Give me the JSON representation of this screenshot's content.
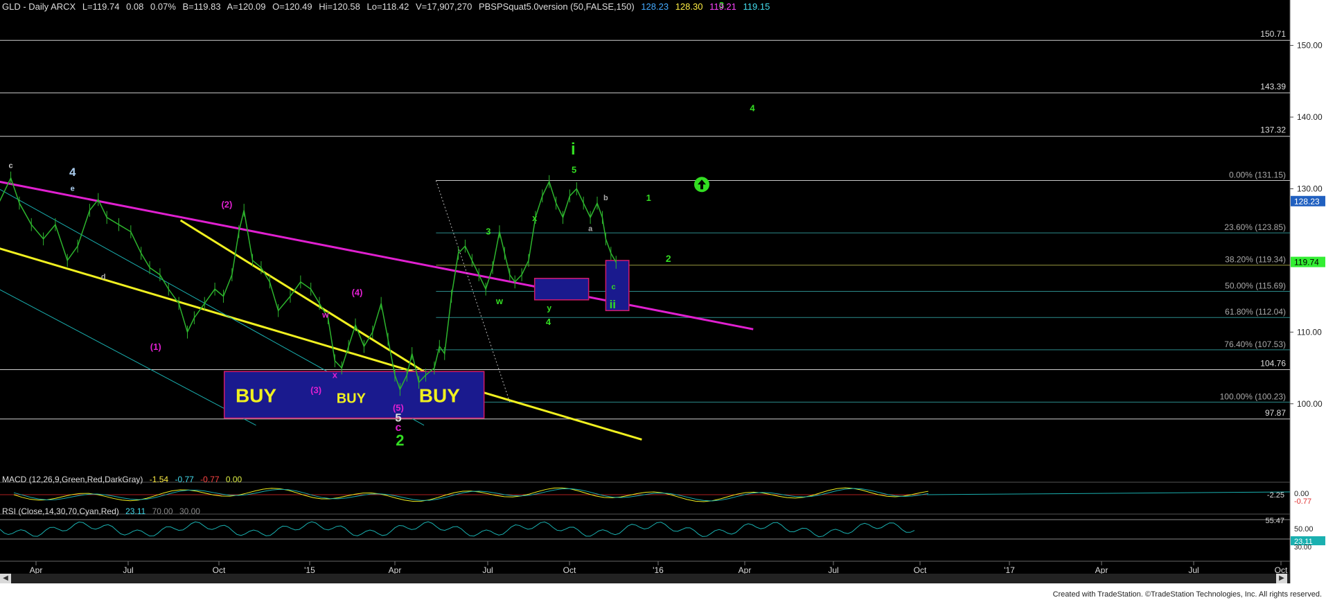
{
  "header": {
    "symbol": "GLD - Daily ARCX",
    "last": "L=119.74",
    "chg": "0.08",
    "pct": "0.07%",
    "bid": "B=119.83",
    "ask": "A=120.09",
    "open": "O=120.49",
    "hi": "Hi=120.58",
    "lo": "Lo=118.42",
    "vol": "V=17,907,270",
    "study": "PBSPSquat5.0version (50,FALSE,150)",
    "v1": "128.23",
    "v2": "128.30",
    "v3": "119.21",
    "v4": "119.15"
  },
  "macd_header": {
    "label": "MACD (12,26,9,Green,Red,DarkGray)",
    "v1": "-1.54",
    "v2": "-0.77",
    "v3": "-0.77",
    "v4": "0.00"
  },
  "rsi_header": {
    "label": "RSI (Close,14,30,70,Cyan,Red)",
    "v1": "23.11",
    "v2": "70.00",
    "v3": "30.00"
  },
  "credit": "Created with TradeStation. ©TradeStation Technologies, Inc. All rights reserved.",
  "colors": {
    "price": "#2db52d",
    "magenta": "#e020d0",
    "yellow": "#f0f020",
    "cyan": "#1ab0b0",
    "box": "#1a1a8e",
    "green_label": "#33dd22"
  },
  "chart_data": {
    "type": "line",
    "title": "GLD - Daily ARCX",
    "x_tick_labels": [
      "Apr",
      "Jul",
      "Oct",
      "'15",
      "Apr",
      "Jul",
      "Oct",
      "'16",
      "Apr",
      "Jul",
      "Oct",
      "'17",
      "Apr",
      "Jul",
      "Oct"
    ],
    "y_tick_labels": [
      "150.00",
      "140.00",
      "130.00",
      "110.00",
      "100.00"
    ],
    "ylim": [
      90.6,
      154.6
    ],
    "price_path": [
      [
        -100,
        128
      ],
      [
        -86,
        131.5
      ],
      [
        -76,
        128
      ],
      [
        -62,
        125
      ],
      [
        -48,
        123
      ],
      [
        -34,
        125
      ],
      [
        -20,
        120
      ],
      [
        -8,
        122
      ],
      [
        6,
        127
      ],
      [
        16,
        128.5
      ],
      [
        26,
        126
      ],
      [
        40,
        125
      ],
      [
        54,
        124
      ],
      [
        66,
        121
      ],
      [
        76,
        119
      ],
      [
        88,
        118
      ],
      [
        98,
        116
      ],
      [
        110,
        114
      ],
      [
        120,
        110
      ],
      [
        128,
        112
      ],
      [
        140,
        114
      ],
      [
        152,
        116
      ],
      [
        162,
        115
      ],
      [
        172,
        118
      ],
      [
        180,
        124
      ],
      [
        186,
        127
      ],
      [
        196,
        120
      ],
      [
        206,
        119
      ],
      [
        216,
        117
      ],
      [
        226,
        113
      ],
      [
        240,
        115
      ],
      [
        252,
        117
      ],
      [
        264,
        116
      ],
      [
        274,
        114
      ],
      [
        284,
        112
      ],
      [
        292,
        106
      ],
      [
        300,
        105
      ],
      [
        308,
        108
      ],
      [
        316,
        111
      ],
      [
        326,
        108
      ],
      [
        336,
        110
      ],
      [
        346,
        114
      ],
      [
        354,
        109
      ],
      [
        362,
        104
      ],
      [
        368,
        102
      ],
      [
        376,
        104
      ],
      [
        382,
        107
      ],
      [
        390,
        103
      ],
      [
        398,
        104
      ],
      [
        408,
        105
      ],
      [
        414,
        108
      ],
      [
        420,
        107
      ],
      [
        428,
        115
      ],
      [
        436,
        121
      ],
      [
        444,
        122
      ],
      [
        452,
        120
      ],
      [
        460,
        118
      ],
      [
        468,
        116
      ],
      [
        476,
        119
      ],
      [
        484,
        124
      ],
      [
        490,
        121
      ],
      [
        496,
        118
      ],
      [
        502,
        117
      ],
      [
        510,
        118
      ],
      [
        518,
        120
      ],
      [
        526,
        126
      ],
      [
        534,
        129
      ],
      [
        542,
        131
      ],
      [
        550,
        128
      ],
      [
        558,
        126
      ],
      [
        566,
        129
      ],
      [
        574,
        130
      ],
      [
        582,
        128
      ],
      [
        590,
        126
      ],
      [
        598,
        128
      ],
      [
        604,
        126
      ],
      [
        608,
        123
      ],
      [
        614,
        121
      ],
      [
        620,
        119.74
      ]
    ],
    "channel_lines": [
      {
        "color": "magenta",
        "points": [
          [
            -100,
            131
          ],
          [
            780,
            110.4
          ]
        ]
      },
      {
        "color": "yellow",
        "points": [
          [
            -100,
            121.7
          ],
          [
            650,
            95
          ]
        ]
      },
      {
        "color": "yellow",
        "points": [
          [
            112,
            125.6
          ],
          [
            416,
            103
          ]
        ]
      },
      {
        "color": "cyan",
        "points": [
          [
            -100,
            130
          ],
          [
            396,
            97
          ]
        ]
      },
      {
        "color": "cyan",
        "points": [
          [
            -100,
            116
          ],
          [
            200,
            97
          ]
        ]
      }
    ],
    "fib_levels": [
      {
        "label": "0.00% (131.15)",
        "value": 131.15
      },
      {
        "label": "23.60% (123.85)",
        "value": 123.85
      },
      {
        "label": "38.20% (119.34)",
        "value": 119.34
      },
      {
        "label": "50.00% (115.69)",
        "value": 115.69
      },
      {
        "label": "61.80% (112.04)",
        "value": 112.04
      },
      {
        "label": "76.40% (107.53)",
        "value": 107.53
      },
      {
        "label": "100.00% (100.23)",
        "value": 100.23
      }
    ],
    "horizontal_levels": [
      {
        "label": "150.71",
        "value": 150.71
      },
      {
        "label": "143.39",
        "value": 143.39
      },
      {
        "label": "137.32",
        "value": 137.32
      },
      {
        "label": "104.76",
        "value": 104.76
      },
      {
        "label": "97.87",
        "value": 97.87
      }
    ],
    "zones": [
      {
        "label": "",
        "color": "box",
        "x0": 163,
        "x1": 466,
        "y0": 98,
        "y1": 104.5
      },
      {
        "label": "",
        "color": "box",
        "x0": 525,
        "x1": 588,
        "y0": 114.5,
        "y1": 117.5
      },
      {
        "label": "",
        "color": "box",
        "x0": 608,
        "x1": 635,
        "y0": 113,
        "y1": 120
      }
    ],
    "buy_labels": [
      {
        "text": "BUY",
        "x": 200,
        "y": 100.2,
        "size": 28
      },
      {
        "text": "BUY",
        "x": 311,
        "y": 100.1,
        "size": 20
      },
      {
        "text": "BUY",
        "x": 414,
        "y": 100.2,
        "size": 28
      }
    ],
    "wave_labels": [
      {
        "text": "c",
        "x": -86,
        "y": 132.9,
        "color": "#cccccc",
        "size": 11
      },
      {
        "text": "4",
        "x": -14,
        "y": 131.8,
        "color": "#aaccee",
        "size": 17
      },
      {
        "text": "e",
        "x": -14,
        "y": 129.7,
        "color": "#aaccee",
        "size": 11
      },
      {
        "text": "d",
        "x": 22,
        "y": 117.4,
        "color": "#aaaaaa",
        "size": 11
      },
      {
        "text": "(1)",
        "x": 83,
        "y": 107.5,
        "color": "magenta",
        "size": 13
      },
      {
        "text": "(2)",
        "x": 166,
        "y": 127.4,
        "color": "magenta",
        "size": 13
      },
      {
        "text": "w",
        "x": 281,
        "y": 112,
        "color": "magenta",
        "size": 12
      },
      {
        "text": "x",
        "x": 292,
        "y": 103.6,
        "color": "magenta",
        "size": 13
      },
      {
        "text": "(3)",
        "x": 270,
        "y": 101.5,
        "color": "magenta",
        "size": 13
      },
      {
        "text": "(4)",
        "x": 318,
        "y": 115.1,
        "color": "magenta",
        "size": 13
      },
      {
        "text": "(5)",
        "x": 366,
        "y": 99,
        "color": "magenta",
        "size": 13
      },
      {
        "text": "5",
        "x": 366,
        "y": 97.5,
        "color": "#dddddd",
        "size": 17
      },
      {
        "text": "c",
        "x": 366,
        "y": 96.2,
        "color": "magenta",
        "size": 16
      },
      {
        "text": "2",
        "x": 368,
        "y": 94.2,
        "color": "green_label",
        "size": 22
      },
      {
        "text": "3",
        "x": 471,
        "y": 123.6,
        "color": "green_label",
        "size": 13
      },
      {
        "text": "w",
        "x": 484,
        "y": 113.9,
        "color": "green_label",
        "size": 13
      },
      {
        "text": "x",
        "x": 525,
        "y": 125.5,
        "color": "green_label",
        "size": 13
      },
      {
        "text": "y",
        "x": 542,
        "y": 113,
        "color": "green_label",
        "size": 12
      },
      {
        "text": "4",
        "x": 541,
        "y": 111,
        "color": "green_label",
        "size": 13
      },
      {
        "text": "i",
        "x": 570,
        "y": 134.8,
        "color": "green_label",
        "size": 24
      },
      {
        "text": "5",
        "x": 571,
        "y": 132.2,
        "color": "green_label",
        "size": 13
      },
      {
        "text": "b",
        "x": 608,
        "y": 128.4,
        "color": "#aaaaaa",
        "size": 11
      },
      {
        "text": "a",
        "x": 590,
        "y": 124.1,
        "color": "#aaaaaa",
        "size": 11
      },
      {
        "text": "c",
        "x": 617,
        "y": 116,
        "color": "green_label",
        "size": 11
      },
      {
        "text": "ii",
        "x": 616,
        "y": 113.3,
        "color": "green_label",
        "size": 17
      },
      {
        "text": "1",
        "x": 658,
        "y": 128.3,
        "color": "green_label",
        "size": 13
      },
      {
        "text": "2",
        "x": 681,
        "y": 119.8,
        "color": "green_label",
        "size": 14
      },
      {
        "text": "3",
        "x": 743,
        "y": 155.2,
        "color": "green_label",
        "size": 13
      },
      {
        "text": "4",
        "x": 779,
        "y": 140.8,
        "color": "green_label",
        "size": 13
      }
    ],
    "price_label": {
      "text": "119.74",
      "value": 119.74
    },
    "side_labels": [
      {
        "text": "128.23",
        "value": 128.23
      }
    ],
    "macd_levels": [
      {
        "label": "-2.25"
      },
      {
        "label": "0.00"
      },
      {
        "label": "-0.77"
      }
    ],
    "rsi_levels": [
      {
        "label": "55.47"
      },
      {
        "label": "50.00"
      },
      {
        "label": "23.11"
      },
      {
        "label": "30.00"
      }
    ]
  }
}
